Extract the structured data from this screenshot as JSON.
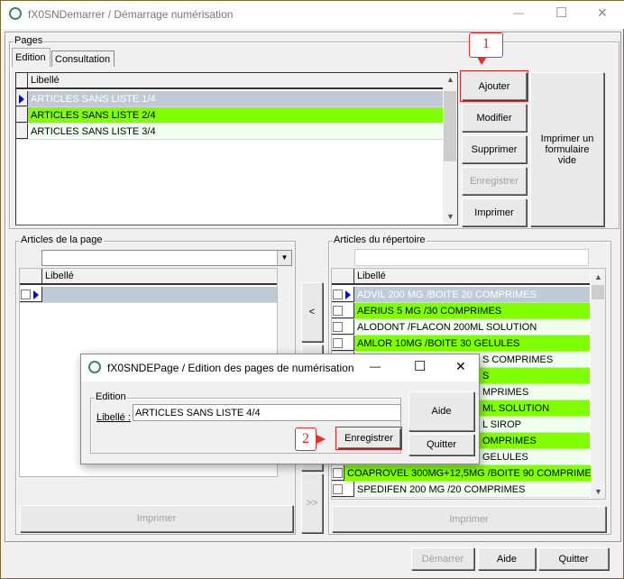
{
  "window": {
    "title": "fX0SNDemarrer / Démarrage numérisation",
    "minimize": "—",
    "maximize": "☐",
    "close": "✕"
  },
  "pages": {
    "group_label": "Pages",
    "tabs": [
      {
        "label": "Edition",
        "active": true
      },
      {
        "label": "Consultation",
        "active": false
      }
    ],
    "grid_header": "Libellé",
    "rows": [
      {
        "label": "ARTICLES SANS LISTE 1/4",
        "color": "#c0cad6",
        "selected": true
      },
      {
        "label": "ARTICLES SANS LISTE 2/4",
        "color": "#80ff00"
      },
      {
        "label": "ARTICLES SANS LISTE 3/4",
        "color": "#f0fff0"
      }
    ],
    "buttons": {
      "add": "Ajouter",
      "modify": "Modifier",
      "delete": "Supprimer",
      "save": "Enregistrer",
      "print": "Imprimer",
      "print_blank": "Imprimer un formulaire vide"
    }
  },
  "callout1": "1",
  "callout2": "2",
  "page_articles": {
    "group_label": "Articles de la page",
    "grid_header": "Libellé",
    "print": "Imprimer"
  },
  "move": {
    "left": "<",
    "all_right": ">>"
  },
  "repertoire": {
    "group_label": "Articles du répertoire",
    "filter_value": "",
    "grid_header": "Libellé",
    "print": "Imprimer",
    "rows": [
      {
        "label": "ADVIL 200 MG /BOITE 20 COMPRIMES",
        "color": "#c0cad6",
        "selected": true
      },
      {
        "label": "AERIUS 5 MG /30 COMPRIMES",
        "color": "#80ff00"
      },
      {
        "label": "ALODONT /FLACON 200ML SOLUTION",
        "color": "#f0fff0"
      },
      {
        "label": "AMLOR 10MG /BOITE 30 GELULES",
        "color": "#80ff00"
      },
      {
        "label": "S COMPRIMES",
        "color": "#f0fff0",
        "partial": true
      },
      {
        "label": "S",
        "color": "#80ff00",
        "partial": true
      },
      {
        "label": "MPRIMES",
        "color": "#f0fff0",
        "partial": true
      },
      {
        "label": "ML SOLUTION",
        "color": "#80ff00",
        "partial": true
      },
      {
        "label": "L SIROP",
        "color": "#f0fff0",
        "partial": true
      },
      {
        "label": "OMPRIMES",
        "color": "#80ff00",
        "partial": true
      },
      {
        "label": "GELULES",
        "color": "#f0fff0",
        "partial": true
      },
      {
        "label": "COAPROVEL 300MG+12,5MG /BOITE 90 COMPRIMES",
        "color": "#80ff00"
      },
      {
        "label": "SPEDIFEN 200 MG /20 COMPRIMES",
        "color": "#f0fff0"
      }
    ]
  },
  "footer": {
    "start": "Démarrer",
    "help": "Aide",
    "quit": "Quitter"
  },
  "dialog": {
    "title": "fX0SNDEPage / Edition des pages de numérisation",
    "group_label": "Edition",
    "field_label": "Libellé :",
    "field_value": "ARTICLES SANS LISTE 4/4",
    "save": "Enregistrer",
    "help": "Aide",
    "quit": "Quitter",
    "minimize": "—",
    "maximize": "☐",
    "close": "✕"
  }
}
